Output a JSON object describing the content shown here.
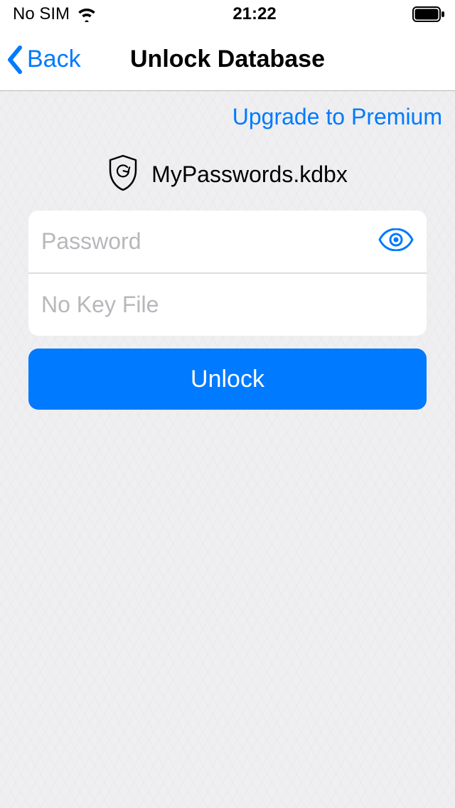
{
  "status": {
    "carrier": "No SIM",
    "time": "21:22"
  },
  "nav": {
    "back_label": "Back",
    "title": "Unlock Database"
  },
  "upgrade_label": "Upgrade to Premium",
  "database": {
    "name": "MyPasswords.kdbx"
  },
  "form": {
    "password_placeholder": "Password",
    "password_value": "",
    "keyfile_label": "No Key File",
    "unlock_label": "Unlock"
  },
  "colors": {
    "accent": "#007aff"
  }
}
